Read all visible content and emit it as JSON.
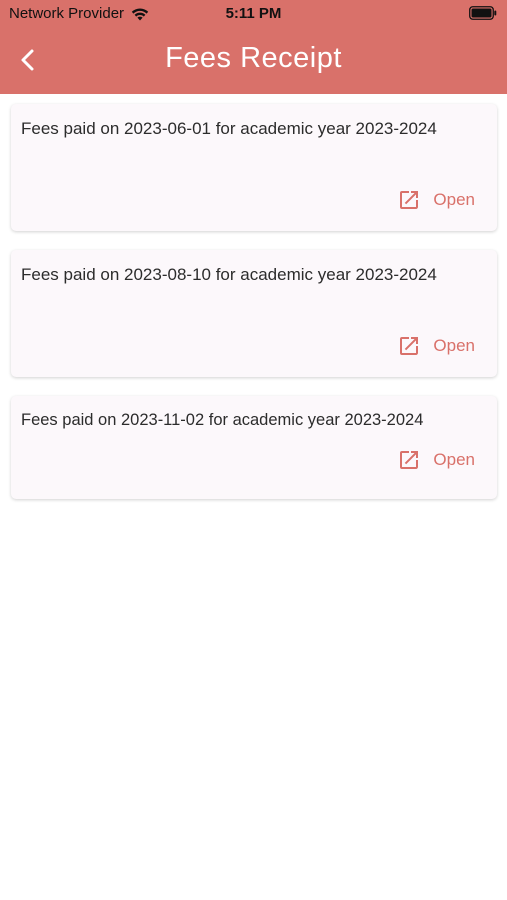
{
  "status_bar": {
    "carrier": "Network Provider",
    "time": "5:11 PM"
  },
  "header": {
    "title": "Fees Receipt",
    "background_color": "#d9716a"
  },
  "receipts": [
    {
      "text": "Fees paid on 2023-06-01 for academic year 2023-2024",
      "action_label": "Open"
    },
    {
      "text": "Fees paid on 2023-08-10 for academic year 2023-2024",
      "action_label": "Open"
    },
    {
      "text": "Fees paid on 2023-11-02 for academic year 2023-2024",
      "action_label": "Open"
    }
  ],
  "icons": {
    "back": "chevron-left-icon",
    "open": "open-in-new-icon",
    "wifi": "wifi-icon",
    "battery": "battery-icon"
  },
  "colors": {
    "accent": "#d9716a",
    "card_background": "#fcf8fb"
  }
}
